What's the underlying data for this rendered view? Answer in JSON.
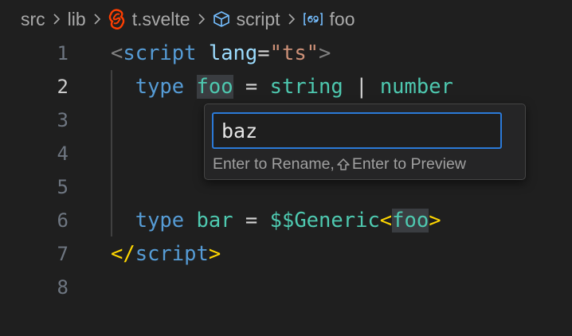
{
  "breadcrumb": {
    "items": [
      {
        "label": "src",
        "icon": null
      },
      {
        "label": "lib",
        "icon": null
      },
      {
        "label": "t.svelte",
        "icon": "svelte-icon"
      },
      {
        "label": "script",
        "icon": "cube-icon"
      },
      {
        "label": "foo",
        "icon": "type-parameter-icon"
      }
    ]
  },
  "editor": {
    "line_numbers": [
      "1",
      "2",
      "3",
      "4",
      "5",
      "6",
      "7",
      "8"
    ],
    "active_line": "2",
    "lines": {
      "l1": {
        "open": "<",
        "tag": "script",
        "attr": "lang",
        "eq": "=",
        "val": "\"ts\"",
        "close": ">"
      },
      "l2": {
        "kw": "type",
        "name": "foo",
        "eq": " = ",
        "t1": "string",
        "pipe": " | ",
        "t2": "number"
      },
      "l6": {
        "kw": "type",
        "name": "bar",
        "eq": " = ",
        "gen": "$$Generic",
        "lt": "<",
        "arg": "foo",
        "gt": ">"
      },
      "l7": {
        "open": "</",
        "tag": "script",
        "close": ">"
      }
    }
  },
  "rename": {
    "value": "baz",
    "hint_part1": "Enter to Rename, ",
    "hint_icon": "shift-icon",
    "hint_part2": "Enter to Preview"
  },
  "colors": {
    "background": "#1f1f1f",
    "keyword": "#569cd6",
    "type": "#4ec9b0",
    "string": "#ce9178",
    "bracket": "#ffd700",
    "focus_border": "#2b7ad8",
    "svelte": "#ff3e00"
  }
}
